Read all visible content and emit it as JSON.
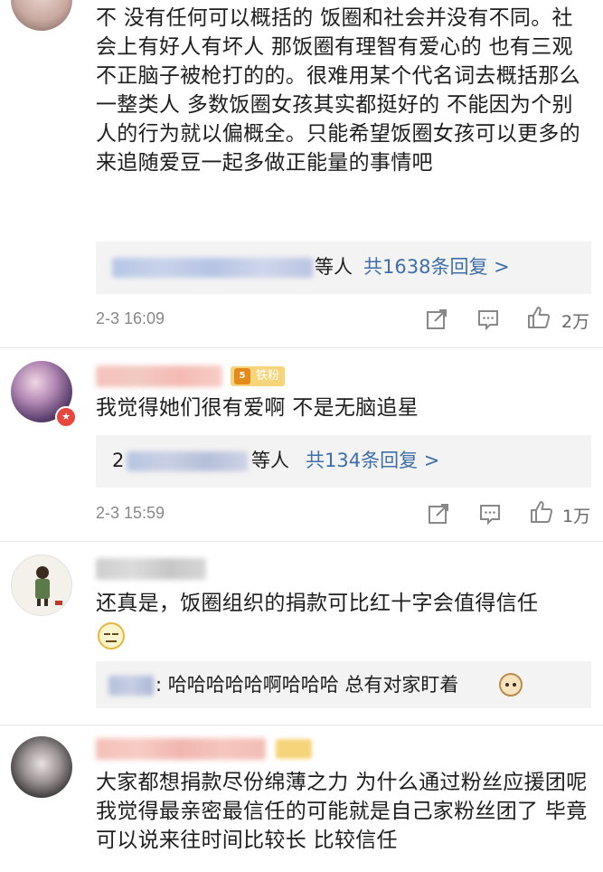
{
  "comments": [
    {
      "text": "不 没有任何可以概括的 饭圈和社会并没有不同。社会上有好人有坏人 那饭圈有理智有爱心的 也有三观不正脑子被枪打的的。很难用某个代名词去概括那么一整类人  多数饭圈女孩其实都挺好的 不能因为个别人的行为就以偏概全。只能希望饭圈女孩可以更多的来追随爱豆一起多做正能量的事情吧",
      "reply_suffix": "等人",
      "reply_count": "共1638条回复 >",
      "time": "2-3 16:09",
      "likes": "2万"
    },
    {
      "badge": "铁粉",
      "text": "我觉得她们很有爱啊 不是无脑追星",
      "reply_prefix": "2",
      "reply_suffix": "等人",
      "reply_count": "共134条回复 >",
      "time": "2-3 15:59",
      "likes": "1万"
    },
    {
      "text": "还真是，饭圈组织的捐款可比红十字会值得信任",
      "reply_text": ": 哈哈哈哈哈啊哈哈哈  总有对家盯着"
    },
    {
      "text": "大家都想捐款尽份绵薄之力 为什么通过粉丝应援团呢 我觉得最亲密最信任的可能就是自己家粉丝团了 毕竟可以说来往时间比较长 比较信任"
    }
  ],
  "colors": {
    "reply_link": "#3f6fa8",
    "meta": "#888888",
    "reply_bg": "#f3f3f3",
    "badge_bg": "#f6d479"
  },
  "icons": [
    "repost-icon",
    "comment-icon",
    "like-icon",
    "medal-icon",
    "smirk-emoji-icon",
    "cat-emoji-icon"
  ]
}
